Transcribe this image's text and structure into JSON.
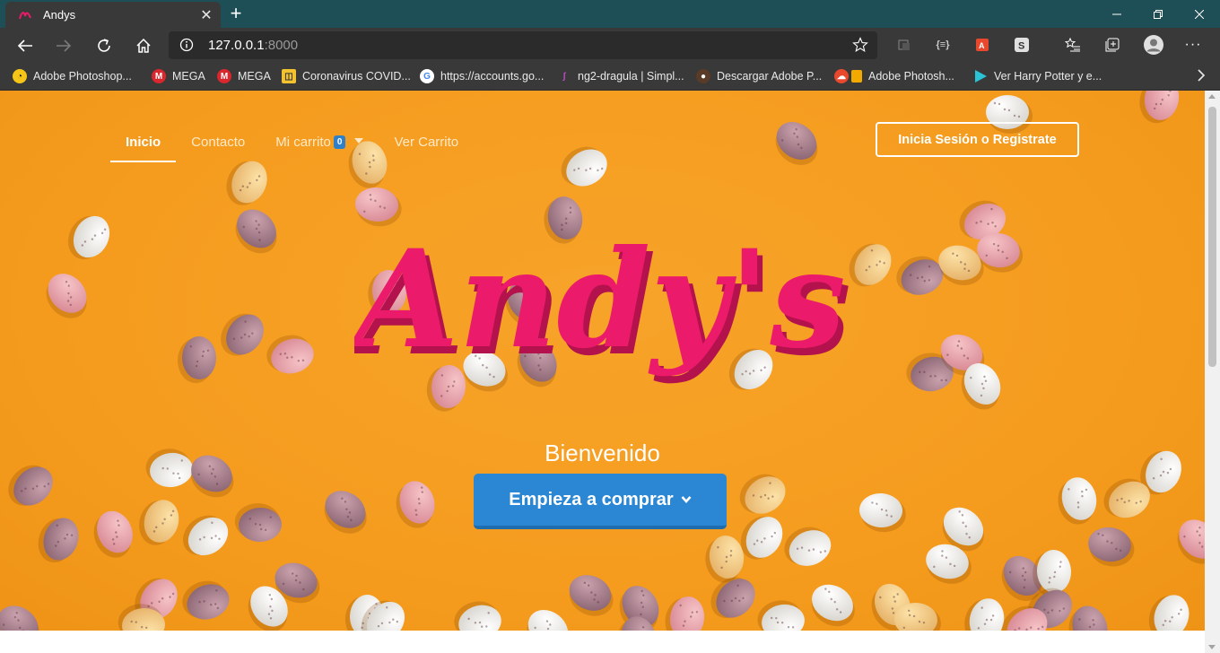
{
  "browser": {
    "tab": {
      "title": "Andys"
    },
    "address": {
      "host": "127.0.0.1",
      "port": ":8000"
    },
    "bookmarks": [
      {
        "label": "Adobe Photoshop...",
        "icon": "adobe-icon"
      },
      {
        "label": "MEGA",
        "icon": "mega-icon"
      },
      {
        "label": "MEGA",
        "icon": "mega-icon"
      },
      {
        "label": "Coronavirus COVID...",
        "icon": "coronavirus-icon"
      },
      {
        "label": "https://accounts.go...",
        "icon": "google-icon"
      },
      {
        "label": "ng2-dragula | Simpl...",
        "icon": "dragula-icon"
      },
      {
        "label": "Descargar Adobe P...",
        "icon": "download-icon"
      },
      {
        "label": "Adobe Photosh...",
        "icon": "adobe-icon"
      },
      {
        "label": "Ver Harry Potter y e...",
        "icon": "play-icon"
      }
    ]
  },
  "site": {
    "nav": {
      "home": "Inicio",
      "contact": "Contacto",
      "cart": "Mi carrito",
      "cart_count": "0",
      "view_cart": "Ver Carrito"
    },
    "login_label": "Inicia Sesión o Registrate",
    "logo_text": "Andy's",
    "welcome": "Bienvenido",
    "cta_label": "Empieza a comprar"
  },
  "colors": {
    "hero_bg": "#f59c1e",
    "logo_pink": "#ec1a6a",
    "cta_blue": "#2b87d3",
    "titlebar": "#1f4f56"
  }
}
